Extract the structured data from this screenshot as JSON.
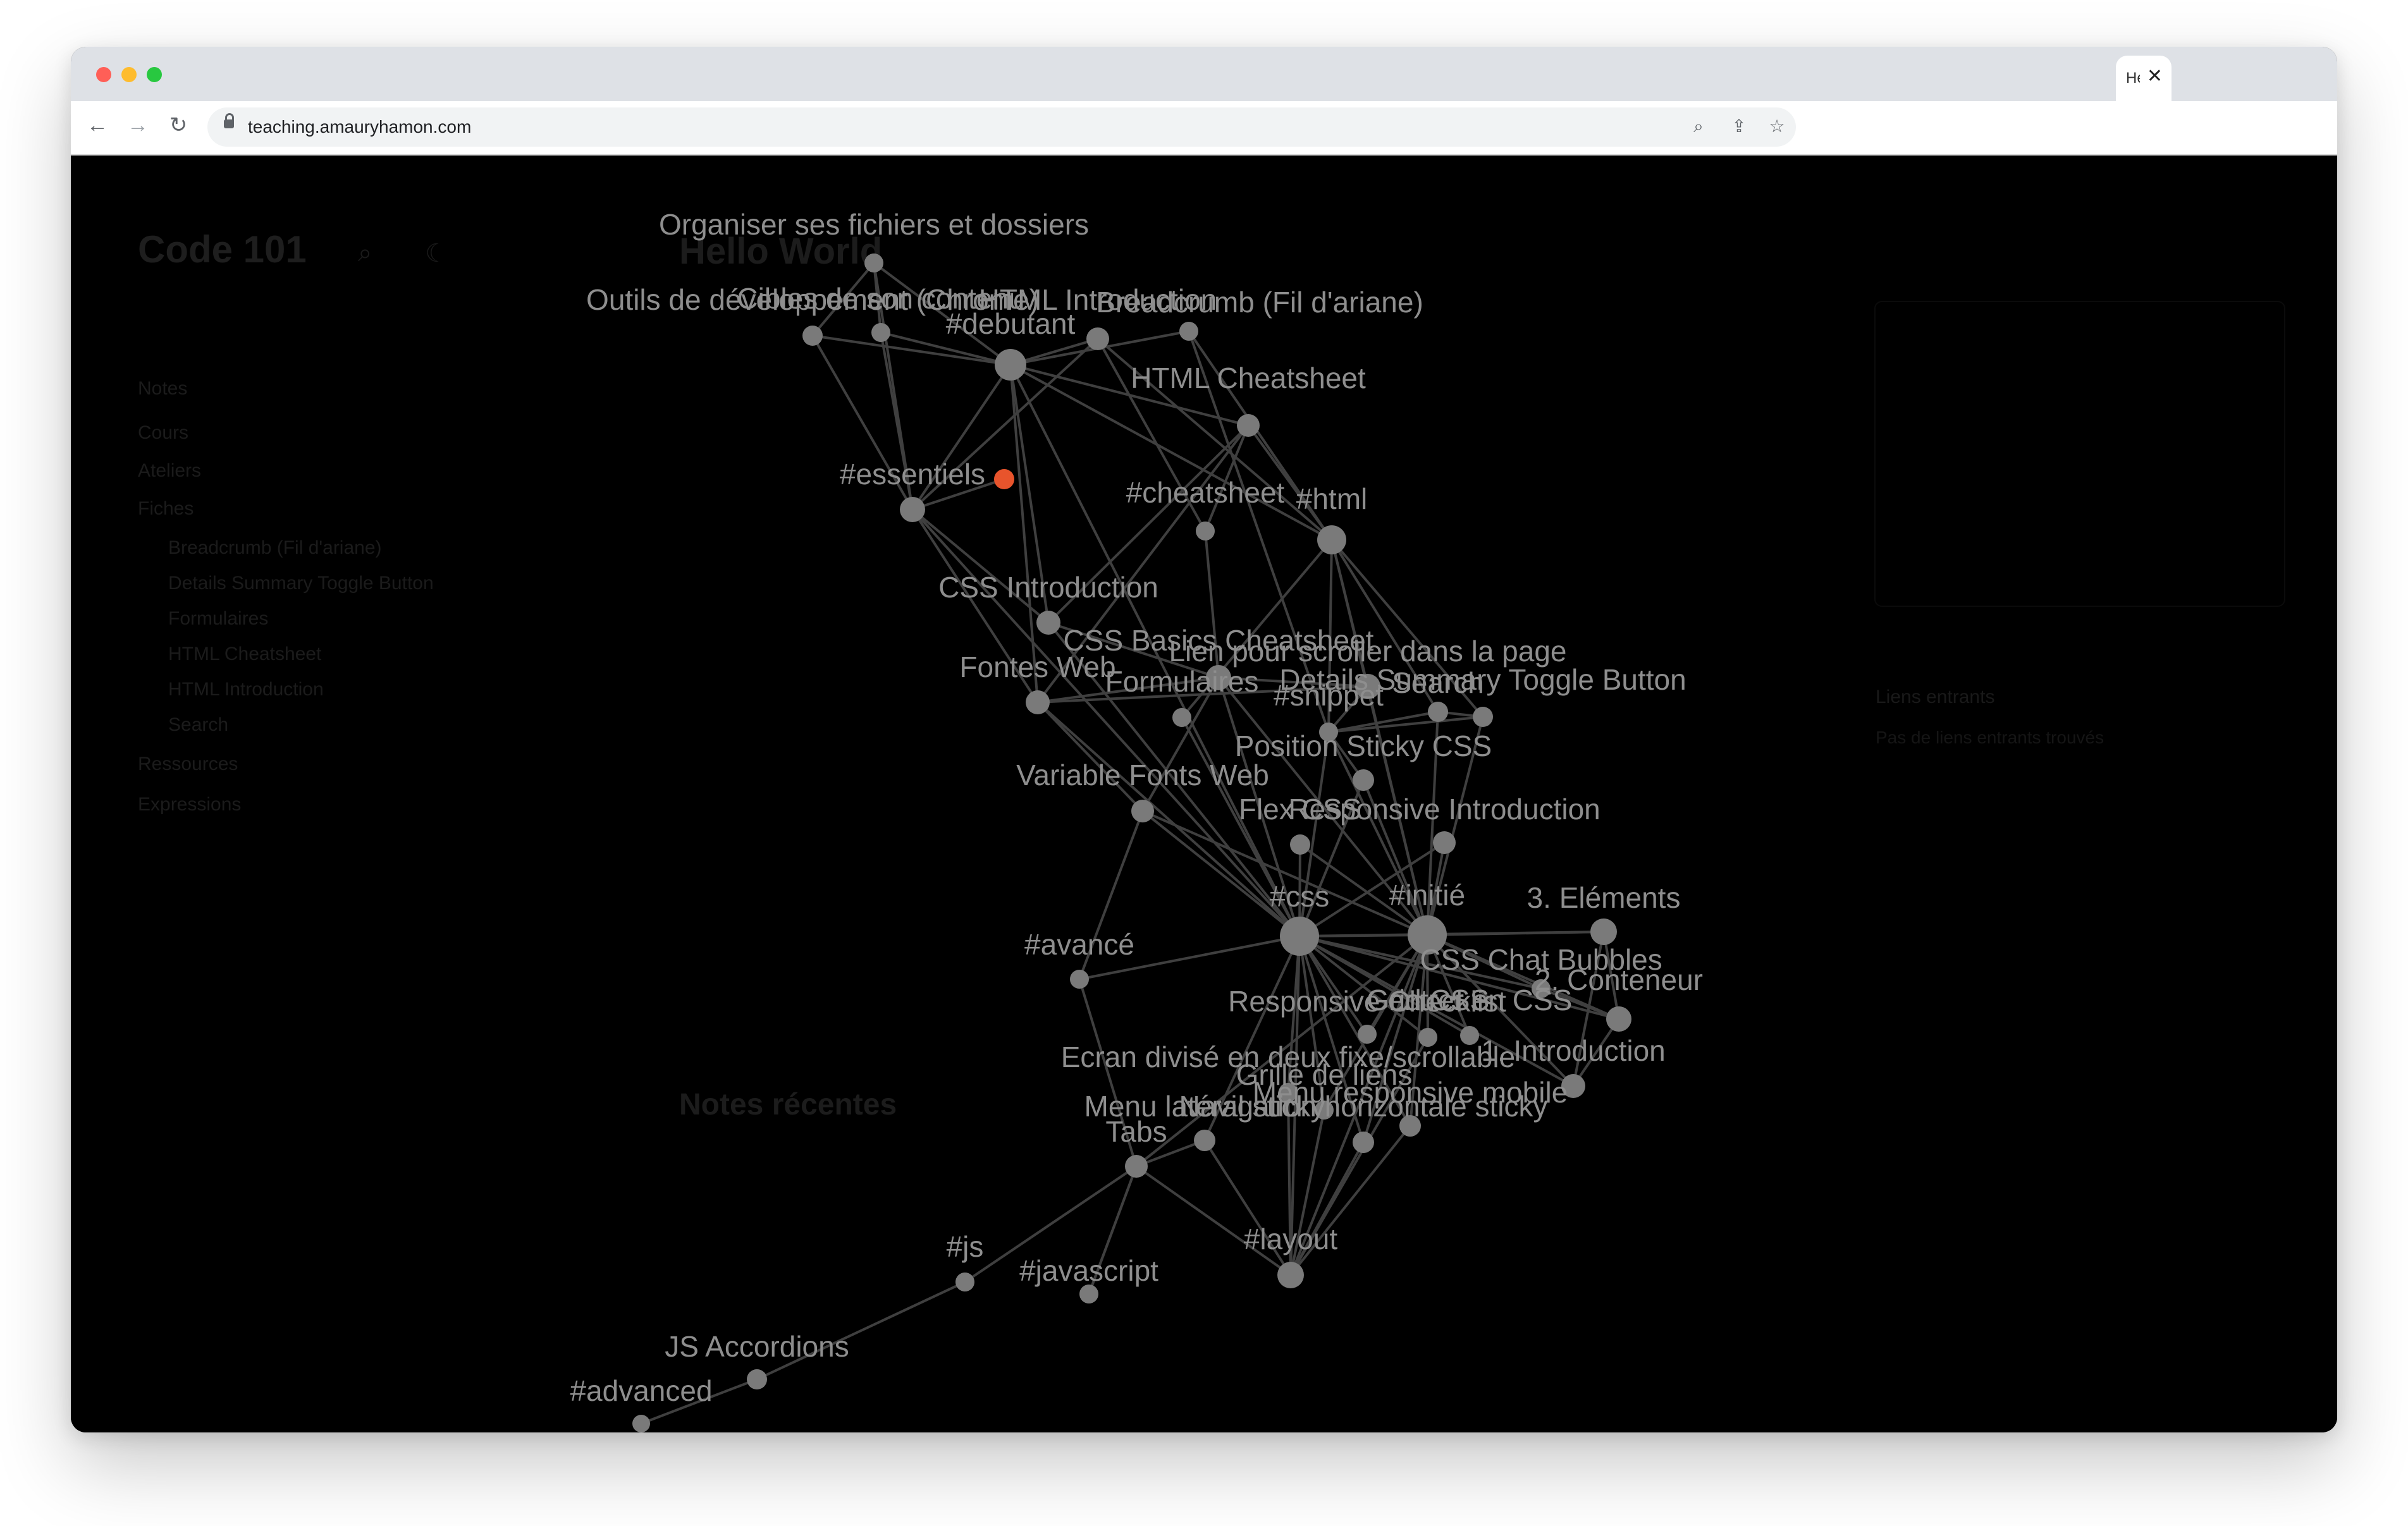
{
  "browser": {
    "tab_title": "Hello World",
    "url": "teaching.amauryhamon.com",
    "icons": [
      "back-arrow-icon",
      "forward-arrow-icon",
      "reload-icon",
      "lock-icon",
      "zoom-icon",
      "share-icon",
      "star-icon",
      "close-icon"
    ]
  },
  "page": {
    "site_title": "Code 101",
    "sidebar": {
      "header": "Notes",
      "items": [
        "Cours",
        "Ateliers",
        "Fiches"
      ],
      "subitems": [
        "Breadcrumb (Fil d'ariane)",
        "Details Summary Toggle Button",
        "Formulaires",
        "HTML Cheatsheet",
        "HTML Introduction",
        "Search"
      ],
      "more_items": [
        "Ressources",
        "Expressions"
      ]
    },
    "title": "Hello World",
    "recent_notes_title": "Notes récentes",
    "right_panel": {
      "title": "Liens entrants",
      "text": "Pas de liens entrants trouvés"
    }
  },
  "graph": {
    "active_color": "#e8542c",
    "node_color": "#7a7a7a",
    "nodes": [
      {
        "id": "organiser",
        "label": "Organiser ses fichiers et dossiers"
      },
      {
        "id": "outils",
        "label": "Outils de développement (Chrome)"
      },
      {
        "id": "cibles",
        "label": "Cibles de son contenu"
      },
      {
        "id": "debutant",
        "label": "#debutant"
      },
      {
        "id": "htmlintro",
        "label": "HTML Introduction"
      },
      {
        "id": "breadcrumb",
        "label": "Breadcrumb (Fil d'ariane)"
      },
      {
        "id": "htmlcheat",
        "label": "HTML Cheatsheet"
      },
      {
        "id": "essentiels",
        "label": "#essentiels"
      },
      {
        "id": "hello",
        "label": ""
      },
      {
        "id": "cheatsheet",
        "label": "#cheatsheet"
      },
      {
        "id": "html",
        "label": "#html"
      },
      {
        "id": "cssintro",
        "label": "CSS Introduction"
      },
      {
        "id": "cssbasics",
        "label": "CSS Basics Cheatsheet"
      },
      {
        "id": "lien",
        "label": "Lien pour scroller dans la page"
      },
      {
        "id": "fontes",
        "label": "Fontes Web"
      },
      {
        "id": "details",
        "label": "Details Summary Toggle Button"
      },
      {
        "id": "formulaires",
        "label": "Formulaires"
      },
      {
        "id": "search",
        "label": "Search"
      },
      {
        "id": "snippet",
        "label": "#snippet"
      },
      {
        "id": "sticky",
        "label": "Position Sticky CSS"
      },
      {
        "id": "varfonts",
        "label": "Variable Fonts Web"
      },
      {
        "id": "flex",
        "label": "Flex CSS"
      },
      {
        "id": "responsive",
        "label": "Responsive Introduction"
      },
      {
        "id": "css",
        "label": "#css"
      },
      {
        "id": "initie",
        "label": "#initié"
      },
      {
        "id": "elements",
        "label": "3. Eléments"
      },
      {
        "id": "avance",
        "label": "#avancé"
      },
      {
        "id": "bubbles",
        "label": "CSS Chat Bubbles"
      },
      {
        "id": "conteneur",
        "label": "2. Conteneur"
      },
      {
        "id": "respcheck",
        "label": "Responsive Checklist"
      },
      {
        "id": "gridcss",
        "label": "Grid CSS"
      },
      {
        "id": "centrer",
        "label": "Centrer en CSS"
      },
      {
        "id": "intro1",
        "label": "1. Introduction"
      },
      {
        "id": "ecran",
        "label": "Ecran divisé en deux fixe/scrollable"
      },
      {
        "id": "grille",
        "label": "Grille de liens"
      },
      {
        "id": "menumob",
        "label": "Menu responsive mobile"
      },
      {
        "id": "menulat",
        "label": "Menu latéral sticky"
      },
      {
        "id": "navhoriz",
        "label": "Navigation horizontale sticky"
      },
      {
        "id": "tabs",
        "label": "Tabs"
      },
      {
        "id": "layout",
        "label": "#layout"
      },
      {
        "id": "js",
        "label": "#js"
      },
      {
        "id": "javascript",
        "label": "#javascript"
      },
      {
        "id": "jsacc",
        "label": "JS Accordions"
      },
      {
        "id": "advanced",
        "label": "#advanced"
      }
    ]
  }
}
